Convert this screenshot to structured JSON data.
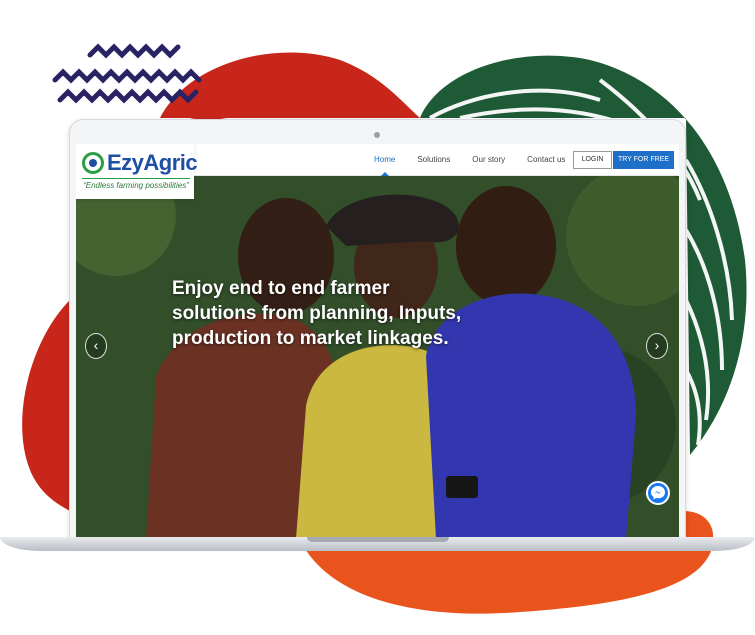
{
  "brand": {
    "name": "EzyAgric",
    "tagline": "“Endless farming possibilities”",
    "primary_color": "#1e4fa3",
    "secondary_color": "#2a9d46"
  },
  "nav": {
    "links": [
      "Home",
      "Solutions",
      "Our story",
      "Contact us"
    ],
    "active": "Home",
    "login_label": "LOGIN",
    "cta_label": "TRY FOR FREE",
    "cta_color": "#1e6fc7"
  },
  "hero": {
    "headline": "Enjoy end to end farmer solutions from planning, Inputs, production to market linkages.",
    "prev_icon": "chevron-left-icon",
    "next_icon": "chevron-right-icon",
    "chat_icon": "messenger-icon"
  },
  "decor": {
    "colors": {
      "red_blob": "#c8261b",
      "orange_blob": "#e8541c",
      "green_blob": "#1e5a36",
      "navy_squiggle": "#2a2363"
    }
  }
}
